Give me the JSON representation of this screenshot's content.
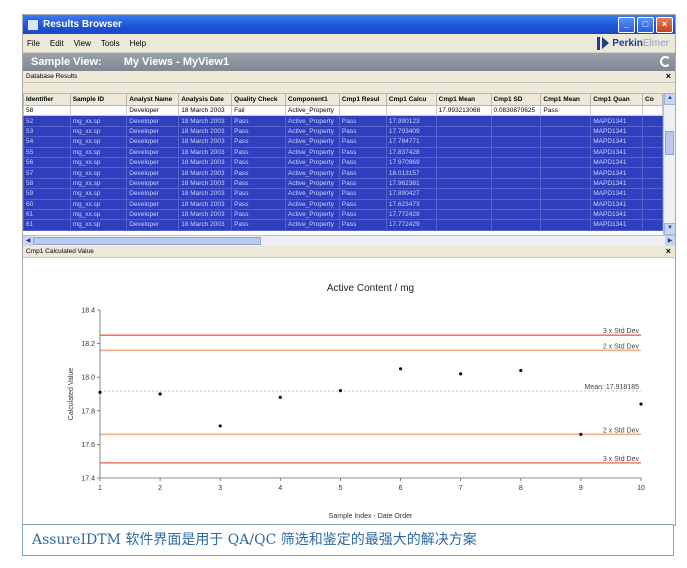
{
  "window": {
    "title": "Results Browser"
  },
  "menu": [
    "File",
    "Edit",
    "View",
    "Tools",
    "Help"
  ],
  "logo": {
    "brand": "Perkin",
    "brand2": "Elmer",
    "sub": "instruments"
  },
  "view": {
    "label": "Sample View:",
    "name": "My Views - MyView1"
  },
  "results_pane": {
    "title": "Database Results"
  },
  "table": {
    "columns": [
      "Identifier",
      "Sample ID",
      "Analyst Name",
      "Analysis Date",
      "Quality Check",
      "Component1",
      "Cmp1 Resul",
      "Cmp1 Calcu",
      "Cmp1 Mean",
      "Cmp1 SD",
      "Cmp1 Mean",
      "Cmp1 Quan",
      "Co"
    ],
    "rows": [
      [
        "58",
        "",
        "Developer",
        "18 March 2003",
        "Fail",
        "Active_Property",
        "",
        "",
        "17.993213068",
        "0.0830870625",
        "Pass",
        "",
        ""
      ],
      [
        "52",
        "mg_xx.sp",
        "Developer",
        "18 March 2003",
        "Pass",
        "Active_Property",
        "Pass",
        "17.990123",
        "",
        "",
        "",
        "MAPD1341",
        ""
      ],
      [
        "53",
        "mg_xx.sp",
        "Developer",
        "18 March 2003",
        "Pass",
        "Active_Property",
        "Pass",
        "17.793409",
        "",
        "",
        "",
        "MAPD1341",
        ""
      ],
      [
        "54",
        "mg_xx.sp",
        "Developer",
        "18 March 2003",
        "Pass",
        "Active_Property",
        "Pass",
        "17.784771",
        "",
        "",
        "",
        "MAPD1341",
        ""
      ],
      [
        "55",
        "mg_xx.sp",
        "Developer",
        "18 March 2003",
        "Pass",
        "Active_Property",
        "Pass",
        "17.837428",
        "",
        "",
        "",
        "MAPD1341",
        ""
      ],
      [
        "56",
        "mg_xx.sp",
        "Developer",
        "18 March 2003",
        "Pass",
        "Active_Property",
        "Pass",
        "17.970969",
        "",
        "",
        "",
        "MAPD1341",
        ""
      ],
      [
        "57",
        "mg_xx.sp",
        "Developer",
        "18 March 2003",
        "Pass",
        "Active_Property",
        "Pass",
        "18.013157",
        "",
        "",
        "",
        "MAPD1341",
        ""
      ],
      [
        "58",
        "mg_xx.sp",
        "Developer",
        "18 March 2003",
        "Pass",
        "Active_Property",
        "Pass",
        "17.962381",
        "",
        "",
        "",
        "MAPD1341",
        ""
      ],
      [
        "59",
        "mg_xx.sp",
        "Developer",
        "18 March 2003",
        "Pass",
        "Active_Property",
        "Pass",
        "17.890427",
        "",
        "",
        "",
        "MAPD1341",
        ""
      ],
      [
        "60",
        "mg_xx.sp",
        "Developer",
        "18 March 2003",
        "Pass",
        "Active_Property",
        "Pass",
        "17.623473",
        "",
        "",
        "",
        "MAPD1341",
        ""
      ],
      [
        "61",
        "mg_xx.sp",
        "Developer",
        "18 March 2003",
        "Pass",
        "Active_Property",
        "Pass",
        "17.772429",
        "",
        "",
        "",
        "MAPD1341",
        ""
      ],
      [
        "61",
        "mg_xx.sp",
        "Developer",
        "18 March 2003",
        "Pass",
        "Active_Property",
        "Pass",
        "17.772429",
        "",
        "",
        "",
        "MAPD1341",
        ""
      ]
    ]
  },
  "chart_pane": {
    "title": "Cmp1 Calculated Value"
  },
  "chart_data": {
    "type": "scatter",
    "title": "Active Content / mg",
    "xlabel": "Sample Index - Date Order",
    "ylabel": "Calculated Value",
    "xlim": [
      1,
      10
    ],
    "ylim": [
      17.4,
      18.4
    ],
    "xticks": [
      1,
      2,
      3,
      4,
      5,
      6,
      7,
      8,
      9,
      10
    ],
    "yticks": [
      17.4,
      17.6,
      17.8,
      18.0,
      18.2,
      18.4
    ],
    "ytick_labels": [
      "17.4",
      "17.6",
      "17.8",
      "18.0",
      "18.2",
      "18.4"
    ],
    "x": [
      1,
      2,
      3,
      4,
      5,
      6,
      7,
      8,
      9,
      10
    ],
    "y": [
      17.91,
      17.9,
      17.71,
      17.88,
      17.92,
      18.05,
      18.02,
      18.04,
      17.66,
      17.84
    ],
    "lines": [
      {
        "label": "3 x Std Dev",
        "y": 18.25,
        "color": "#f07a6a"
      },
      {
        "label": "2 x Std Dev",
        "y": 18.16,
        "color": "#f0b088"
      },
      {
        "label": "Mean: 17.918185",
        "y": 17.918,
        "color": "#b0b0b0",
        "dashed": true
      },
      {
        "label": "2 x Std Dev",
        "y": 17.66,
        "color": "#f0b088"
      },
      {
        "label": "3 x Std Dev",
        "y": 17.49,
        "color": "#f07a6a"
      }
    ]
  },
  "caption": "AssureIDTM 软件界面是用于 QA/QC 筛选和鉴定的最强大的解决方案"
}
